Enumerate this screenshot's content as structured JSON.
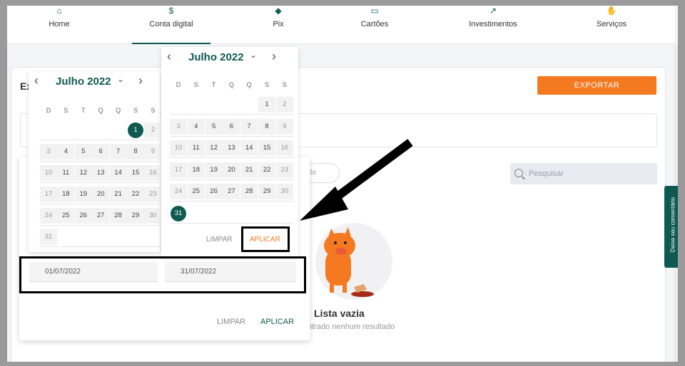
{
  "nav": {
    "items": [
      {
        "label": "Home",
        "icon": "home-icon"
      },
      {
        "label": "Conta digital",
        "icon": "dollar-icon"
      },
      {
        "label": "Pix",
        "icon": "pix-icon"
      },
      {
        "label": "Cartões",
        "icon": "card-icon"
      },
      {
        "label": "Investimentos",
        "icon": "trend-icon"
      },
      {
        "label": "Serviços",
        "icon": "hand-icon"
      }
    ],
    "active_index": 1
  },
  "card": {
    "title": "Ex",
    "export_label": "EXPORTAR",
    "chip_label": "ída",
    "search_placeholder": "Pesquisar",
    "empty_title": "Lista vazia",
    "empty_subtitle": "ntrado nenhum resultado"
  },
  "feedback_tab": "Deixe seu comentário",
  "popup": {
    "start_date": "01/07/2022",
    "end_date": "31/07/2022",
    "clear_label": "LIMPAR",
    "apply_label": "APLICAR"
  },
  "calendar_left": {
    "month": "Julho 2022",
    "weekdays": [
      "D",
      "S",
      "T",
      "Q",
      "Q",
      "S",
      "S"
    ],
    "selected_day": "1"
  },
  "calendar_right": {
    "month": "Julho 2022",
    "weekdays": [
      "D",
      "S",
      "T",
      "Q",
      "Q",
      "S",
      "S"
    ],
    "selected_day": "31",
    "clear_label": "LIMPAR",
    "apply_label": "APLICAR"
  },
  "colors": {
    "brand_green": "#0e5a52",
    "accent_orange": "#f47920"
  }
}
